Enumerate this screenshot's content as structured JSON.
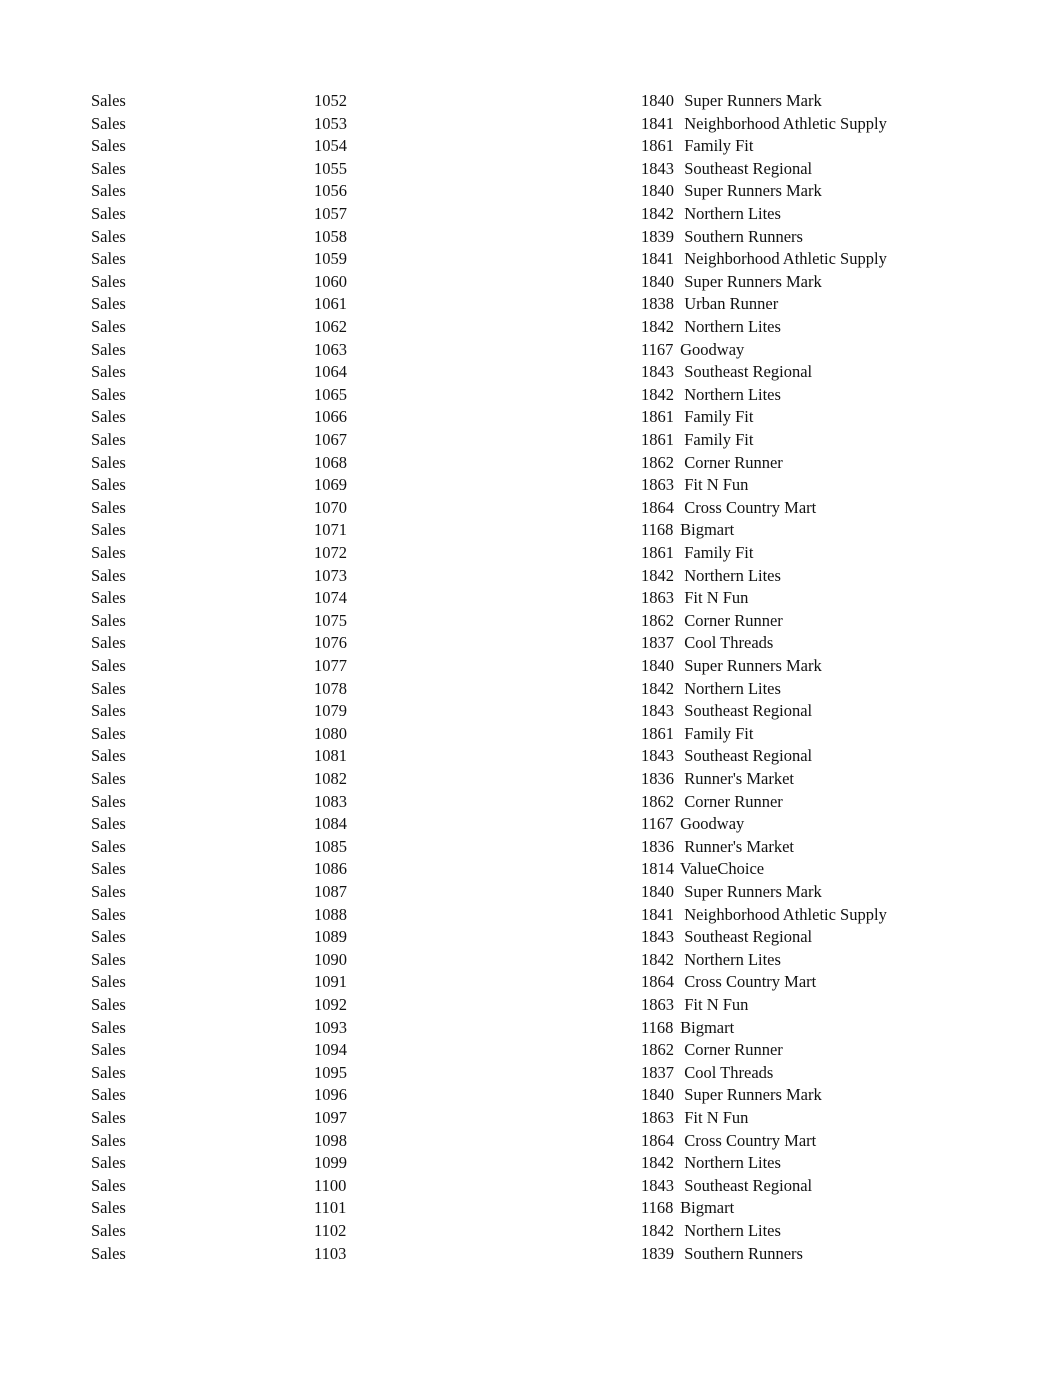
{
  "rows": [
    [
      "Sales",
      "1052",
      "1840",
      "  Super Runners Mark"
    ],
    [
      "Sales",
      "1053",
      "1841",
      "  Neighborhood Athletic Supply"
    ],
    [
      "Sales",
      "1054",
      "1861",
      "  Family Fit"
    ],
    [
      "Sales",
      "1055",
      "1843",
      "  Southeast Regional"
    ],
    [
      "Sales",
      "1056",
      "1840",
      "  Super Runners Mark"
    ],
    [
      "Sales",
      "1057",
      "1842",
      "  Northern Lites"
    ],
    [
      "Sales",
      "1058",
      "1839",
      "  Southern Runners"
    ],
    [
      "Sales",
      "1059",
      "1841",
      "  Neighborhood Athletic Supply"
    ],
    [
      "Sales",
      "1060",
      "1840",
      "  Super Runners Mark"
    ],
    [
      "Sales",
      "1061",
      "1838",
      "  Urban Runner"
    ],
    [
      "Sales",
      "1062",
      "1842",
      "  Northern Lites"
    ],
    [
      "Sales",
      "1063",
      "1167",
      " Goodway"
    ],
    [
      "Sales",
      "1064",
      "1843",
      "  Southeast Regional"
    ],
    [
      "Sales",
      "1065",
      "1842",
      "  Northern Lites"
    ],
    [
      "Sales",
      "1066",
      "1861",
      "  Family Fit"
    ],
    [
      "Sales",
      "1067",
      "1861",
      "  Family Fit"
    ],
    [
      "Sales",
      "1068",
      "1862",
      "  Corner Runner"
    ],
    [
      "Sales",
      "1069",
      "1863",
      "  Fit N Fun"
    ],
    [
      "Sales",
      "1070",
      "1864",
      "  Cross Country Mart"
    ],
    [
      "Sales",
      "1071",
      "1168",
      " Bigmart"
    ],
    [
      "Sales",
      "1072",
      "1861",
      "  Family Fit"
    ],
    [
      "Sales",
      "1073",
      "1842",
      "  Northern Lites"
    ],
    [
      "Sales",
      "1074",
      "1863",
      "  Fit N Fun"
    ],
    [
      "Sales",
      "1075",
      "1862",
      "  Corner Runner"
    ],
    [
      "Sales",
      "1076",
      "1837",
      "  Cool Threads"
    ],
    [
      "Sales",
      "1077",
      "1840",
      "  Super Runners Mark"
    ],
    [
      "Sales",
      "1078",
      "1842",
      "  Northern Lites"
    ],
    [
      "Sales",
      "1079",
      "1843",
      "  Southeast Regional"
    ],
    [
      "Sales",
      "1080",
      "1861",
      "  Family Fit"
    ],
    [
      "Sales",
      "1081",
      "1843",
      "  Southeast Regional"
    ],
    [
      "Sales",
      "1082",
      "1836",
      "  Runner's Market"
    ],
    [
      "Sales",
      "1083",
      "1862",
      "  Corner Runner"
    ],
    [
      "Sales",
      "1084",
      "1167",
      " Goodway"
    ],
    [
      "Sales",
      "1085",
      "1836",
      "  Runner's Market"
    ],
    [
      "Sales",
      "1086",
      "1814",
      " ValueChoice"
    ],
    [
      "Sales",
      "1087",
      "1840",
      "  Super Runners Mark"
    ],
    [
      "Sales",
      "1088",
      "1841",
      "  Neighborhood Athletic Supply"
    ],
    [
      "Sales",
      "1089",
      "1843",
      "  Southeast Regional"
    ],
    [
      "Sales",
      "1090",
      "1842",
      "  Northern Lites"
    ],
    [
      "Sales",
      "1091",
      "1864",
      "  Cross Country Mart"
    ],
    [
      "Sales",
      "1092",
      "1863",
      "  Fit N Fun"
    ],
    [
      "Sales",
      "1093",
      "1168",
      " Bigmart"
    ],
    [
      "Sales",
      "1094",
      "1862",
      "  Corner Runner"
    ],
    [
      "Sales",
      "1095",
      "1837",
      "  Cool Threads"
    ],
    [
      "Sales",
      "1096",
      "1840",
      "  Super Runners Mark"
    ],
    [
      "Sales",
      "1097",
      "1863",
      "  Fit N Fun"
    ],
    [
      "Sales",
      "1098",
      "1864",
      "  Cross Country Mart"
    ],
    [
      "Sales",
      "1099",
      "1842",
      "  Northern Lites"
    ],
    [
      "Sales",
      "1100",
      "1843",
      "  Southeast Regional"
    ],
    [
      "Sales",
      "1101",
      "1168",
      " Bigmart"
    ],
    [
      "Sales",
      "1102",
      "1842",
      "  Northern Lites"
    ],
    [
      "Sales",
      "1103",
      "1839",
      "  Southern Runners"
    ]
  ]
}
